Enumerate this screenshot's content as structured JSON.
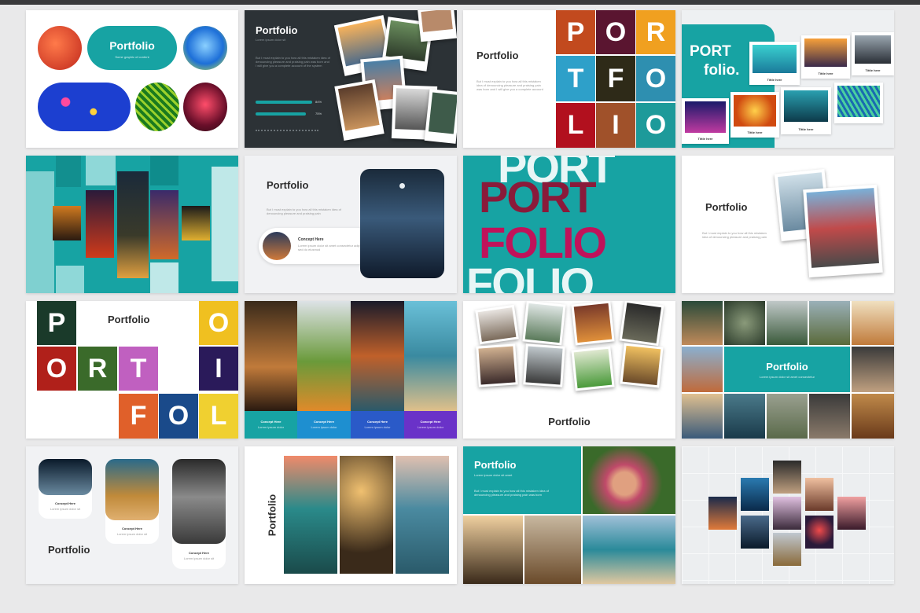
{
  "colors": {
    "teal": "#17a3a3",
    "dark": "#2d2d2d",
    "background": "#e9e9ea"
  },
  "slides": {
    "s1": {
      "title": "Portfolio",
      "subtitle": "Some graphic of content"
    },
    "s2": {
      "title": "Portfolio",
      "subtitle": "Lorem ipsum dolor sit",
      "body": "But I must explain to you how all this mistaken idea of denouncing pleasure and praising pain was born and I will give you a complete account of the system",
      "stat1": "84%",
      "stat2": "75%"
    },
    "s3": {
      "title": "Portfolio",
      "body": "But I must explain to you how all this mistaken idea of denouncing pleasure and praising pain was born and I will give you a complete account",
      "letters": [
        "P",
        "O",
        "R",
        "T",
        "F",
        "O",
        "L",
        "I",
        "O"
      ]
    },
    "s4": {
      "heading1": "PORT",
      "heading2": "folio.",
      "captions": [
        "Tittle here",
        "Tittle here",
        "Tittle here",
        "Tittle here",
        "Tittle here",
        "Tittle here"
      ]
    },
    "s6": {
      "title": "Portfolio",
      "body": "But I must explain to you how all this mistaken idea of denouncing pleasure and praising pain",
      "concept": "Concept Here",
      "concept_body": "Lorem ipsum dolor sit amet consectetur adipiscing elit sed do eiusmod"
    },
    "s7": {
      "line1": "PORT",
      "line2": "FOLIO"
    },
    "s8": {
      "title": "Portfolio",
      "body": "But I must explain to you how all this mistaken idea of denouncing pleasure and praising pain"
    },
    "s9": {
      "title": "Portfolio",
      "letters": [
        "P",
        "O",
        "O",
        "R",
        "T",
        "I",
        "F",
        "O",
        "L"
      ]
    },
    "s10": {
      "captions": [
        "Concept Here",
        "Concept Here",
        "Concept Here",
        "Concept Here"
      ],
      "sub": "Lorem ipsum dolor"
    },
    "s11": {
      "title": "Portfolio"
    },
    "s12": {
      "title": "Portfolio",
      "subtitle": "Lorem ipsum dolor sit amet consectetur"
    },
    "s13": {
      "title": "Portfolio",
      "captions": [
        "Concept Here",
        "Concept Here",
        "Concept Here"
      ],
      "sub": "Lorem ipsum dolor sit"
    },
    "s14": {
      "title": "Portfolio"
    },
    "s15": {
      "title": "Portfolio",
      "subtitle": "Lorem ipsum dolor sit amet",
      "body": "But I must explain to you how all this mistaken idea of denouncing pleasure and praising pain was born"
    }
  }
}
